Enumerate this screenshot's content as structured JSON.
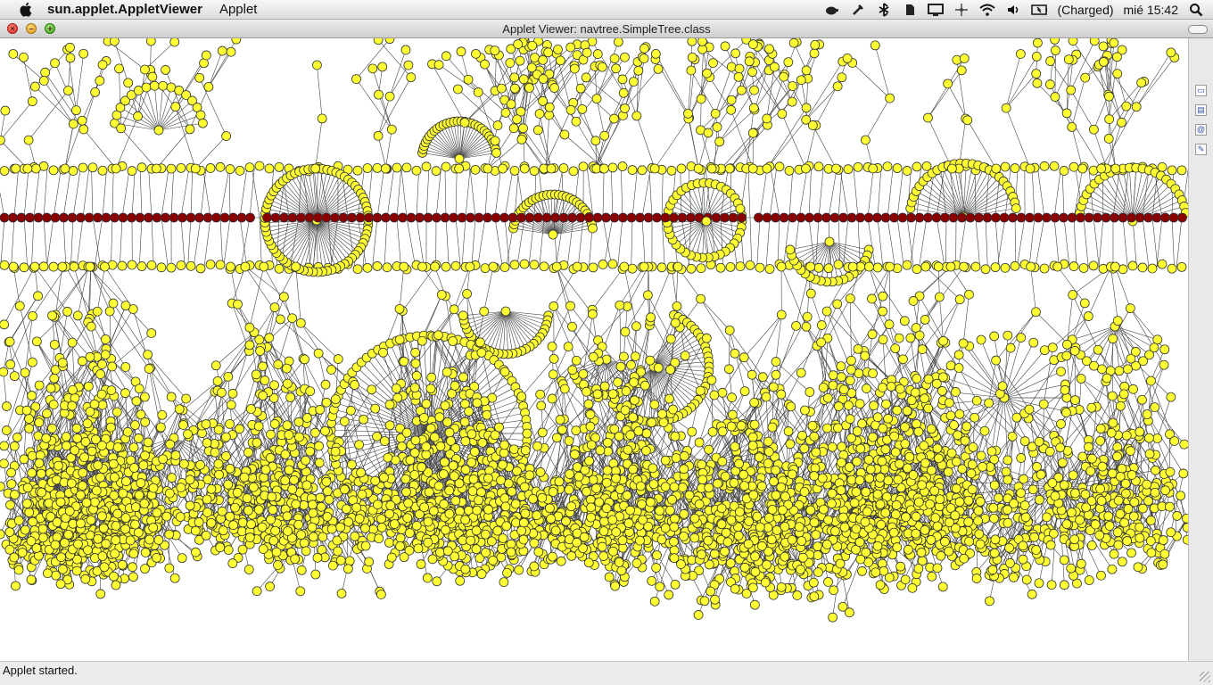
{
  "menubar": {
    "app_name": "sun.applet.AppletViewer",
    "menus": [
      "Applet"
    ],
    "battery": "(Charged)",
    "clock": "mié 15:42",
    "status_icons": [
      "java-icon",
      "tool-icon",
      "bluetooth-icon",
      "evernote-icon",
      "display-icon",
      "move-icon",
      "wifi-icon",
      "volume-icon",
      "battery-icon",
      "spotlight-icon"
    ]
  },
  "window": {
    "title": "Applet Viewer: navtree.SimpleTree.class"
  },
  "statusbar": {
    "text": "Applet started."
  },
  "colors": {
    "node_fill": "#ffff33",
    "node_stroke": "#333333",
    "selected_node_fill": "#8b0000",
    "edge": "#444444"
  },
  "sidestrip": {
    "icons": [
      "window-icon",
      "bookmark-icon",
      "at-icon",
      "note-icon"
    ]
  }
}
